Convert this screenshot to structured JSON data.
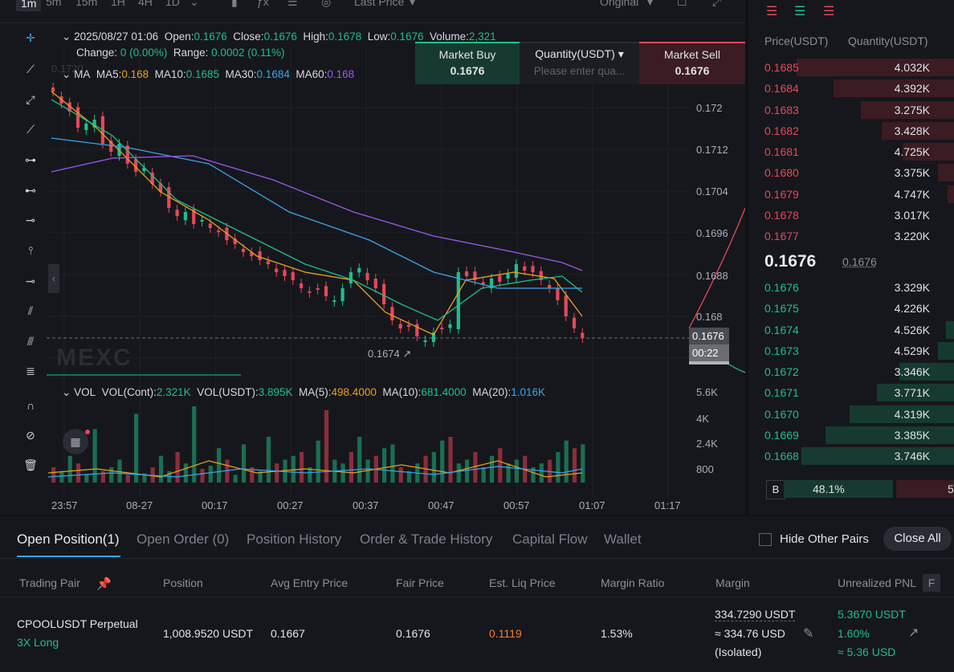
{
  "timeframes": [
    "1m",
    "5m",
    "15m",
    "1H",
    "4H",
    "1D"
  ],
  "topbar": {
    "price_type": "Last Price",
    "mode": "Original"
  },
  "info": {
    "date": "2025/08/27 01:06",
    "open_label": "Open:",
    "open": "0.1676",
    "close_label": "Close:",
    "close": "0.1676",
    "high_label": "High:",
    "high": "0.1678",
    "low_label": "Low:",
    "low": "0.1676",
    "volume_label": "Volume:",
    "volume": "2,321",
    "change_label": "Change:",
    "change": "0 (0.00%)",
    "range_label": "Range:",
    "range": "0.0002 (0.11%)"
  },
  "ma": {
    "label": "MA",
    "ma5_label": "MA5:",
    "ma5": "0.168",
    "ma10_label": "MA10:",
    "ma10": "0.1685",
    "ma30_label": "MA30:",
    "ma30": "0.1684",
    "ma60_label": "MA60:",
    "ma60": "0.168",
    "partial_price": "0.1720"
  },
  "market": {
    "buy_label": "Market Buy",
    "buy_price": "0.1676",
    "qty_label": "Quantity(USDT)",
    "qty_placeholder": "Please enter qua...",
    "sell_label": "Market Sell",
    "sell_price": "0.1676",
    "close_icon": "close-icon"
  },
  "price_axis": [
    "0.172",
    "0.1712",
    "0.1704",
    "0.1696",
    "0.1688",
    "0.168"
  ],
  "current_price": {
    "price": "0.1676",
    "countdown": "00:22"
  },
  "low_marker": "0.1674",
  "watermark": "MEXC",
  "vol": {
    "label": "VOL",
    "cont_label": "VOL(Cont):",
    "cont": "2.321K",
    "usdt_label": "VOL(USDT):",
    "usdt": "3.895K",
    "ma5_label": "MA(5):",
    "ma5": "498.4000",
    "ma10_label": "MA(10):",
    "ma10": "681.4000",
    "ma20_label": "MA(20):",
    "ma20": "1.016K"
  },
  "vol_axis": [
    "5.6K",
    "4K",
    "2.4K",
    "800"
  ],
  "time_axis": [
    "23:57",
    "08-27",
    "00:17",
    "00:27",
    "00:37",
    "00:47",
    "00:57",
    "01:07",
    "01:17"
  ],
  "orderbook": {
    "price_header": "Price(USDT)",
    "qty_header": "Quantity(USDT)",
    "asks": [
      {
        "price": "0.1685",
        "qty": "4.032K",
        "depth": 0.98
      },
      {
        "price": "0.1684",
        "qty": "4.392K",
        "depth": 0.75
      },
      {
        "price": "0.1683",
        "qty": "3.275K",
        "depth": 0.58
      },
      {
        "price": "0.1682",
        "qty": "3.428K",
        "depth": 0.45
      },
      {
        "price": "0.1681",
        "qty": "4.725K",
        "depth": 0.32
      },
      {
        "price": "0.1680",
        "qty": "3.375K",
        "depth": 0.1
      },
      {
        "price": "0.1679",
        "qty": "4.747K",
        "depth": 0.04
      },
      {
        "price": "0.1678",
        "qty": "3.017K",
        "depth": 0
      },
      {
        "price": "0.1677",
        "qty": "3.220K",
        "depth": 0
      }
    ],
    "mid_price": "0.1676",
    "mid_ref": "0.1676",
    "bids": [
      {
        "price": "0.1676",
        "qty": "3.329K",
        "depth": 0
      },
      {
        "price": "0.1675",
        "qty": "4.226K",
        "depth": 0
      },
      {
        "price": "0.1674",
        "qty": "4.526K",
        "depth": 0.05
      },
      {
        "price": "0.1673",
        "qty": "4.529K",
        "depth": 0.1
      },
      {
        "price": "0.1672",
        "qty": "3.346K",
        "depth": 0.34
      },
      {
        "price": "0.1671",
        "qty": "3.771K",
        "depth": 0.48
      },
      {
        "price": "0.1670",
        "qty": "4.319K",
        "depth": 0.65
      },
      {
        "price": "0.1669",
        "qty": "3.385K",
        "depth": 0.8
      },
      {
        "price": "0.1668",
        "qty": "3.746K",
        "depth": 0.95
      }
    ],
    "buy_letter": "B",
    "buy_pct": "48.1%",
    "sell_partial": "5"
  },
  "bottom": {
    "tabs": [
      "Open Position(1)",
      "Open Order (0)",
      "Position History",
      "Order & Trade History",
      "Capital Flow",
      "Wallet"
    ],
    "hide_label": "Hide Other Pairs",
    "close_all": "Close All",
    "headers": {
      "pair": "Trading Pair",
      "position": "Position",
      "avg": "Avg Entry Price",
      "fair": "Fair Price",
      "liq": "Est. Liq Price",
      "ratio": "Margin Ratio",
      "margin": "Margin",
      "pnl": "Unrealized PNL",
      "f": "F"
    },
    "row": {
      "pair": "CPOOLUSDT Perpetual",
      "side": "3X Long",
      "position": "1,008.9520 USDT",
      "avg": "0.1667",
      "fair": "0.1676",
      "liq": "0.1119",
      "ratio": "1.53%",
      "margin1": "334.7290 USDT",
      "margin2": "≈ 334.76 USD",
      "margin3": "(Isolated)",
      "pnl1": "5.3670 USDT",
      "pnl2": "1.60%",
      "pnl3": "≈ 5.36 USD"
    }
  },
  "colors": {
    "up": "#1fbf8a",
    "down": "#e5485a",
    "ma5": "#e8a020",
    "ma10": "#1fbf8a",
    "ma30": "#3aa5e8",
    "ma60": "#9b59e8"
  }
}
